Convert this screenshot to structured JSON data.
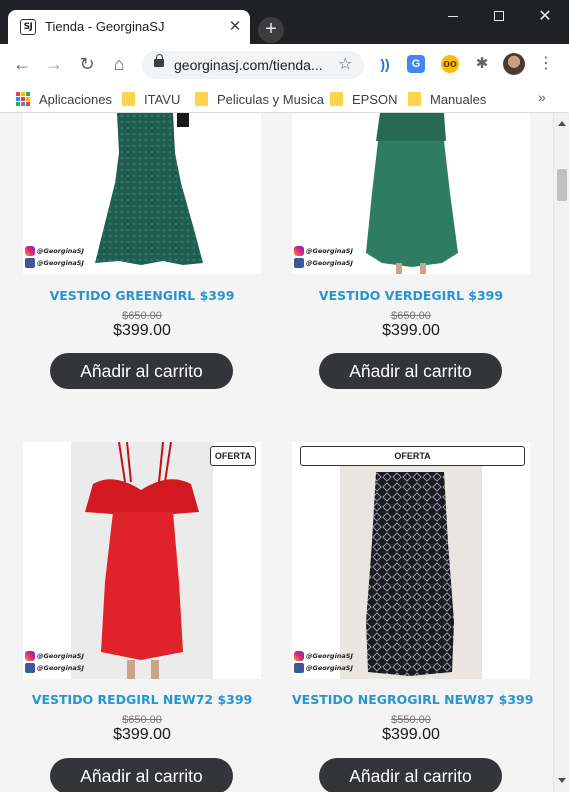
{
  "browser": {
    "tab_title": "Tienda - GeorginaSJ",
    "favicon_text": "SJ",
    "url": "georginasj.com/tienda...",
    "bookmarks": [
      "Aplicaciones",
      "ITAVU",
      "Peliculas y Musica",
      "EPSON",
      "Manuales"
    ]
  },
  "colors": {
    "product_name": "#2596d1",
    "button": "#333538",
    "titlebar": "#202124"
  },
  "social_handle": "@GeorginaSJ",
  "products": [
    {
      "name": "VESTIDO GREENGIRL $399",
      "old_price": "$650.00",
      "price": "$399.00",
      "button": "Añadir al carrito",
      "badge": ""
    },
    {
      "name": "VESTIDO VERDEGIRL $399",
      "old_price": "$650.00",
      "price": "$399.00",
      "button": "Añadir al carrito",
      "badge": ""
    },
    {
      "name": "VESTIDO REDGIRL NEW72 $399",
      "old_price": "$650.00",
      "price": "$399.00",
      "button": "Añadir al carrito",
      "badge": "OFERTA"
    },
    {
      "name": "VESTIDO NEGROGIRL NEW87 $399",
      "old_price": "$550.00",
      "price": "$399.00",
      "button": "Añadir al carrito",
      "badge": "OFERTA"
    }
  ]
}
